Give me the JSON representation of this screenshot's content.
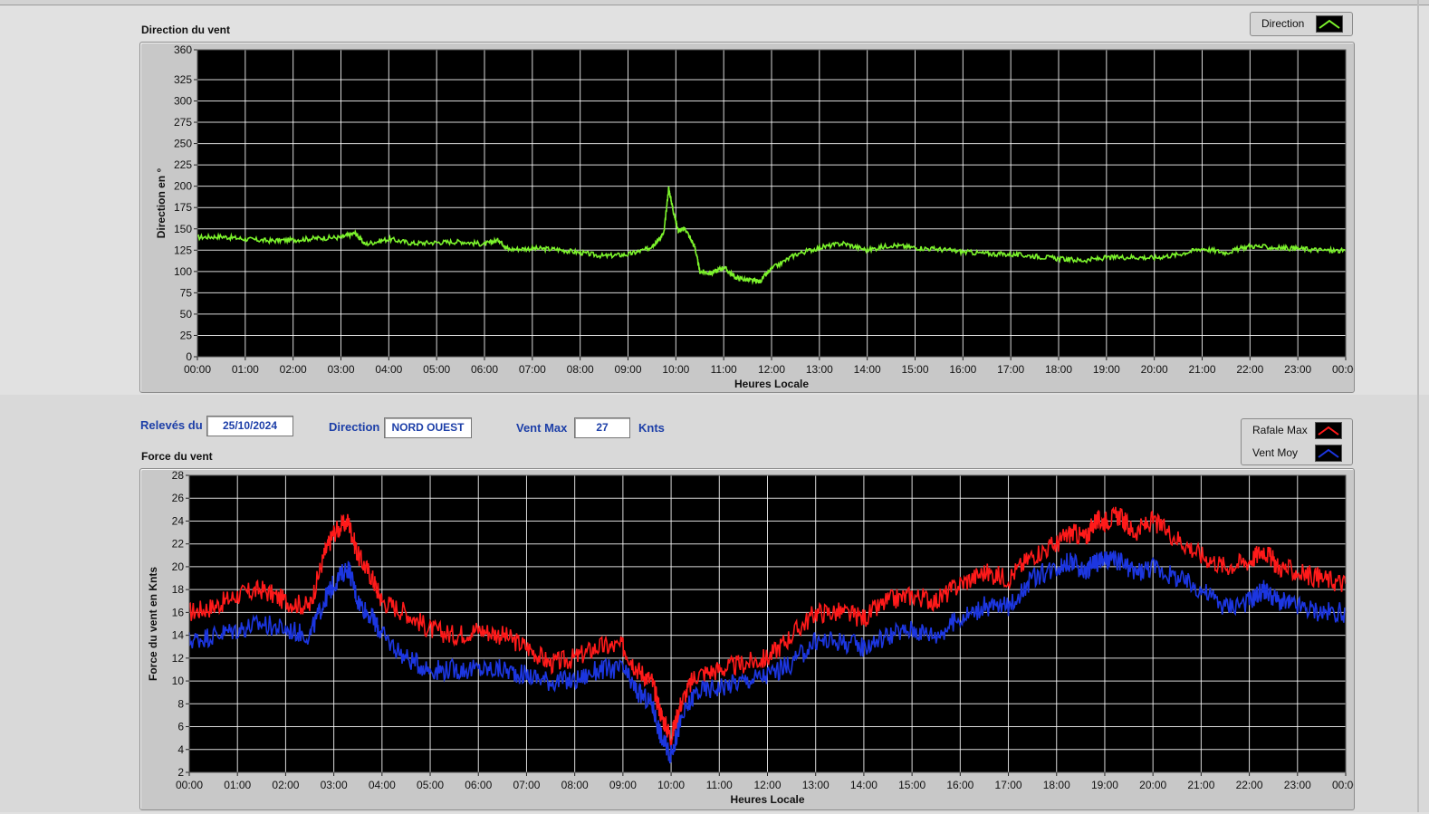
{
  "colors": {
    "direction": "#7cf32c",
    "rafale": "#ff1a1a",
    "vent_moy": "#1c36e0",
    "info_text": "#1d3fa8",
    "plot_bg": "#000000",
    "grid": "#ffffff"
  },
  "info": {
    "releves_label": "Relevés du",
    "date": "25/10/2024",
    "direction_label": "Direction",
    "direction_value": "NORD OUEST",
    "vent_max_label": "Vent Max",
    "vent_max_value": "27",
    "unit": "Knts"
  },
  "chart_data": [
    {
      "id": "direction",
      "type": "line",
      "title": "Direction du vent",
      "xlabel": "Heures Locale",
      "ylabel": "Direction en °",
      "xlim": [
        0,
        24
      ],
      "ylim": [
        0,
        360
      ],
      "yticks": [
        0,
        25,
        50,
        75,
        100,
        125,
        150,
        175,
        200,
        225,
        250,
        275,
        300,
        325,
        360
      ],
      "xticks": [
        "00:00",
        "01:00",
        "02:00",
        "03:00",
        "04:00",
        "05:00",
        "06:00",
        "07:00",
        "08:00",
        "09:00",
        "10:00",
        "11:00",
        "12:00",
        "13:00",
        "14:00",
        "15:00",
        "16:00",
        "17:00",
        "18:00",
        "19:00",
        "20:00",
        "21:00",
        "22:00",
        "23:00",
        "00:00"
      ],
      "grid": true,
      "legend_position": "top-right",
      "series": [
        {
          "name": "Direction",
          "color": "#7cf32c",
          "x": [
            0,
            0.5,
            1,
            1.5,
            2,
            2.5,
            3,
            3.3,
            3.5,
            4,
            4.5,
            5,
            5.5,
            6,
            6.3,
            6.5,
            7,
            7.5,
            8,
            8.5,
            9,
            9.4,
            9.6,
            9.75,
            9.85,
            9.95,
            10.05,
            10.2,
            10.4,
            10.5,
            10.75,
            11,
            11.25,
            11.5,
            11.75,
            12,
            12.5,
            13,
            13.5,
            14,
            14.5,
            15,
            15.5,
            16,
            16.5,
            17,
            17.5,
            18,
            18.5,
            19,
            19.5,
            20,
            20.5,
            21,
            21.5,
            22,
            22.5,
            23,
            23.5,
            24
          ],
          "y": [
            140,
            141,
            138,
            136,
            137,
            139,
            140,
            145,
            132,
            138,
            133,
            134,
            135,
            132,
            137,
            126,
            127,
            126,
            122,
            118,
            120,
            126,
            135,
            145,
            198,
            170,
            148,
            150,
            128,
            100,
            98,
            105,
            93,
            90,
            88,
            103,
            120,
            128,
            133,
            125,
            131,
            128,
            126,
            123,
            121,
            120,
            118,
            115,
            113,
            116,
            117,
            116,
            120,
            127,
            122,
            130,
            128,
            127,
            125,
            124
          ]
        }
      ]
    },
    {
      "id": "force",
      "type": "line",
      "title": "Force du vent",
      "xlabel": "Heures Locale",
      "ylabel": "Force du vent en Knts",
      "xlim": [
        0,
        24
      ],
      "ylim": [
        2,
        28
      ],
      "yticks": [
        2,
        4,
        6,
        8,
        10,
        12,
        14,
        16,
        18,
        20,
        22,
        24,
        26,
        28
      ],
      "xticks": [
        "00:00",
        "01:00",
        "02:00",
        "03:00",
        "04:00",
        "05:00",
        "06:00",
        "07:00",
        "08:00",
        "09:00",
        "10:00",
        "11:00",
        "12:00",
        "13:00",
        "14:00",
        "15:00",
        "16:00",
        "17:00",
        "18:00",
        "19:00",
        "20:00",
        "21:00",
        "22:00",
        "23:00",
        "00:00"
      ],
      "grid": true,
      "legend_position": "top-right",
      "series": [
        {
          "name": "Rafale Max",
          "color": "#ff1a1a",
          "x": [
            0,
            0.5,
            1,
            1.5,
            2,
            2.5,
            2.8,
            3,
            3.3,
            3.5,
            3.8,
            4,
            4.5,
            5,
            5.5,
            6,
            6.5,
            7,
            7.5,
            8,
            8.5,
            9,
            9.3,
            9.6,
            9.8,
            10,
            10.2,
            10.5,
            11,
            11.5,
            12,
            12.5,
            13,
            13.5,
            14,
            14.5,
            15,
            15.5,
            16,
            16.5,
            17,
            17.5,
            18,
            18.3,
            18.6,
            18.8,
            19,
            19.3,
            19.6,
            20,
            20.5,
            21,
            21.5,
            22,
            22.3,
            22.6,
            23,
            23.5,
            24
          ],
          "y": [
            16,
            16.5,
            17.5,
            18,
            17,
            16.5,
            21,
            23,
            24,
            21,
            19,
            17,
            16,
            14.5,
            14,
            14.5,
            14,
            13,
            11.5,
            12,
            13,
            13,
            11,
            10,
            7,
            5,
            8,
            10.5,
            11,
            11.5,
            12,
            14,
            16,
            16,
            15.5,
            17,
            17.5,
            17,
            18.5,
            19.5,
            19,
            21,
            22,
            23,
            22.5,
            24,
            24,
            24.5,
            23,
            24,
            22.5,
            21,
            20,
            20.5,
            21.5,
            20,
            19.5,
            19,
            18.5
          ]
        },
        {
          "name": "Vent Moy",
          "color": "#1c36e0",
          "x": [
            0,
            0.5,
            1,
            1.5,
            2,
            2.5,
            2.8,
            3,
            3.3,
            3.5,
            3.8,
            4,
            4.5,
            5,
            5.5,
            6,
            6.5,
            7,
            7.5,
            8,
            8.5,
            9,
            9.3,
            9.6,
            9.8,
            10,
            10.2,
            10.5,
            11,
            11.5,
            12,
            12.5,
            13,
            13.5,
            14,
            14.5,
            15,
            15.5,
            16,
            16.5,
            17,
            17.5,
            18,
            18.3,
            18.6,
            18.8,
            19,
            19.3,
            19.6,
            20,
            20.5,
            21,
            21.5,
            22,
            22.3,
            22.6,
            23,
            23.5,
            24
          ],
          "y": [
            13.5,
            14,
            14.5,
            15,
            14.5,
            14,
            17,
            18.5,
            20,
            17,
            15.5,
            14,
            12,
            11,
            11,
            11,
            11,
            10.5,
            10,
            10,
            11,
            11,
            9,
            8,
            5,
            3.5,
            6.5,
            9,
            9.5,
            10,
            10.5,
            11.5,
            13.5,
            13.5,
            13,
            14,
            14.5,
            14,
            15.5,
            16.5,
            16.5,
            19,
            20,
            20.5,
            19.5,
            20.5,
            20.5,
            20.5,
            19.5,
            20,
            19,
            18,
            16.5,
            17,
            18,
            17,
            16.5,
            16,
            16
          ]
        }
      ]
    }
  ]
}
